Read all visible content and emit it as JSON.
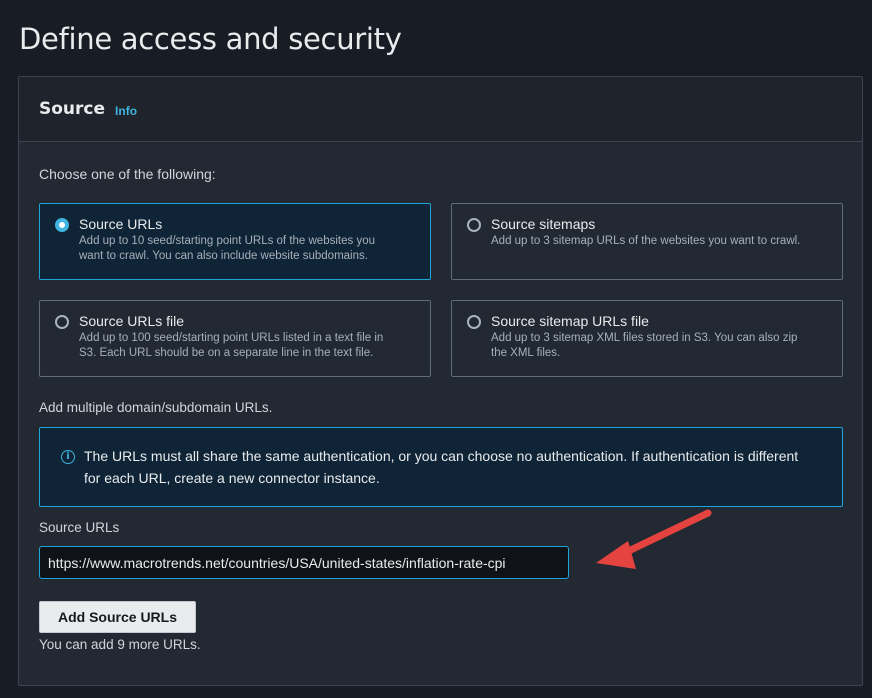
{
  "page": {
    "title": "Define access and security"
  },
  "panel": {
    "title": "Source",
    "info_link": "Info",
    "choose_label": "Choose one of the following:",
    "options": [
      {
        "title": "Source URLs",
        "desc_1": "Add up to 10 seed/starting point URLs of the websites you",
        "desc_2": "want to crawl. You can also include website subdomains.",
        "selected": true
      },
      {
        "title": "Source sitemaps",
        "desc_1": "Add up to 3 sitemap URLs of the websites you want to crawl.",
        "desc_2": "",
        "selected": false
      },
      {
        "title": "Source URLs file",
        "desc_1": "Add up to 100 seed/starting point URLs listed in a text file in",
        "desc_2": "S3. Each URL should be on a separate line in the text file.",
        "selected": false
      },
      {
        "title": "Source sitemap URLs file",
        "desc_1": "Add up to 3 sitemap XML files stored in S3. You can also zip",
        "desc_2": "the XML files.",
        "selected": false
      }
    ],
    "multi_label": "Add multiple domain/subdomain URLs.",
    "alert": {
      "line_1": "The URLs must all share the same authentication, or you can choose no authentication. If authentication is different",
      "line_2": "for each URL, create a new connector instance."
    },
    "source_urls": {
      "label": "Source URLs",
      "value": "https://www.macrotrends.net/countries/USA/united-states/inflation-rate-cpi"
    },
    "add_button": "Add Source URLs",
    "hint": "You can add 9 more URLs."
  },
  "colors": {
    "background": "#181c24",
    "panel": "#232932",
    "accent": "#1ca5d6",
    "annotation_arrow": "#e5433f"
  },
  "icons": {
    "info": "info-circle-icon",
    "annotation": "red-arrow-icon"
  }
}
